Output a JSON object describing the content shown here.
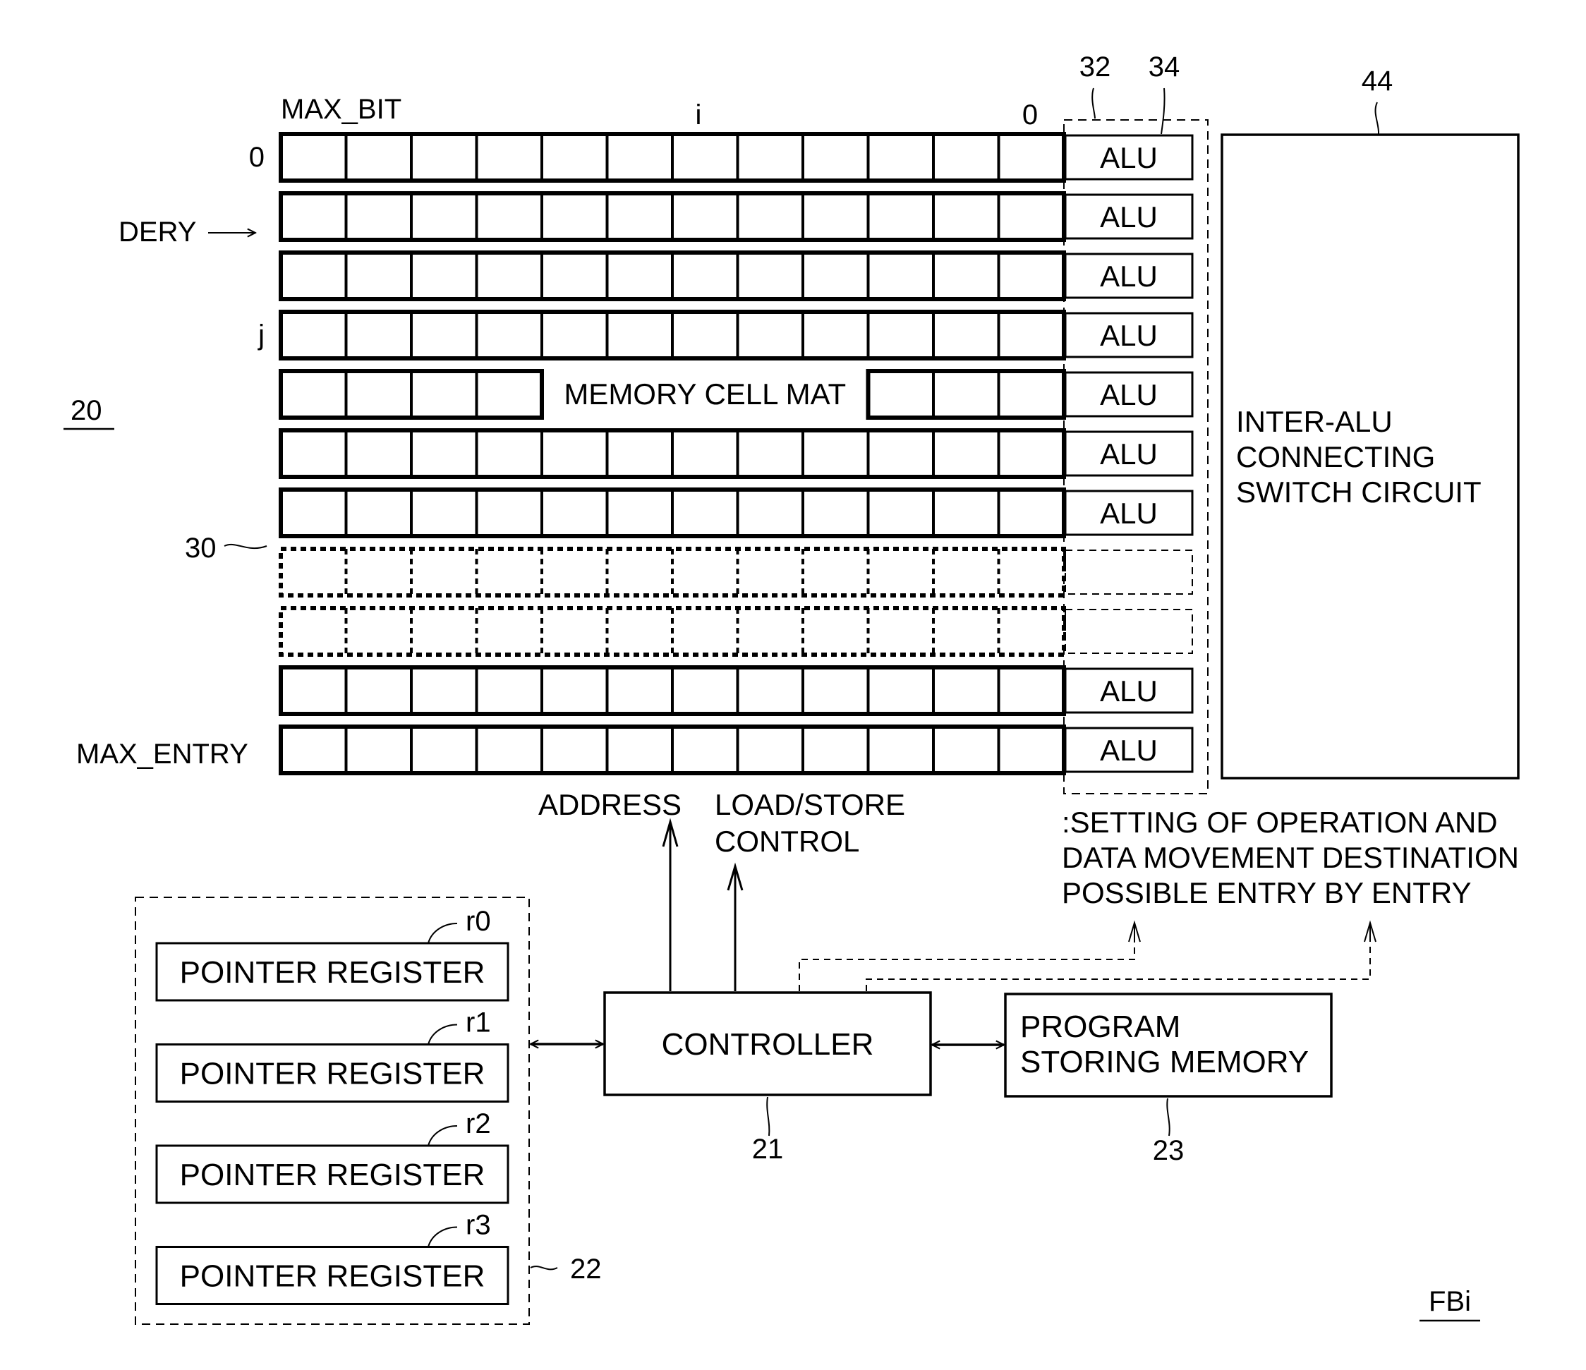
{
  "figure_label": "FBi",
  "block_ref": "20",
  "memory_mat": {
    "label": "MEMORY CELL MAT",
    "ref": "30",
    "col_label_left": "MAX_BIT",
    "col_label_mid": "i",
    "col_label_right": "0",
    "row_label_top": "0",
    "row_label_dery": "DERY",
    "row_label_j": "j",
    "row_label_bottom": "MAX_ENTRY",
    "cols_per_entry": 12,
    "rows": [
      {
        "style": "solid",
        "alu": "ALU"
      },
      {
        "style": "solid",
        "alu": "ALU"
      },
      {
        "style": "solid",
        "alu": "ALU"
      },
      {
        "style": "solid",
        "alu": "ALU"
      },
      {
        "style": "label",
        "alu": "ALU"
      },
      {
        "style": "solid",
        "alu": "ALU"
      },
      {
        "style": "solid",
        "alu": "ALU"
      },
      {
        "style": "dotted",
        "alu": ""
      },
      {
        "style": "dotted",
        "alu": ""
      },
      {
        "style": "solid",
        "alu": "ALU"
      },
      {
        "style": "solid",
        "alu": "ALU"
      }
    ]
  },
  "alu_group": {
    "ref_group": "32",
    "ref_alu": "34"
  },
  "switch_circuit": {
    "ref": "44",
    "lines": [
      "INTER-ALU",
      "CONNECTING",
      "SWITCH CIRCUIT"
    ]
  },
  "signals": {
    "address": "ADDRESS",
    "load_store": [
      "LOAD/STORE",
      "CONTROL"
    ],
    "setting_note": [
      ":SETTING OF OPERATION AND",
      "DATA MOVEMENT DESTINATION",
      "POSSIBLE ENTRY BY ENTRY"
    ]
  },
  "controller": {
    "label": "CONTROLLER",
    "ref": "21"
  },
  "program_memory": {
    "lines": [
      "PROGRAM",
      "STORING MEMORY"
    ],
    "ref": "23"
  },
  "pointer_registers": {
    "ref": "22",
    "items": [
      {
        "label": "POINTER REGISTER",
        "ref": "r0"
      },
      {
        "label": "POINTER REGISTER",
        "ref": "r1"
      },
      {
        "label": "POINTER REGISTER",
        "ref": "r2"
      },
      {
        "label": "POINTER REGISTER",
        "ref": "r3"
      }
    ]
  }
}
